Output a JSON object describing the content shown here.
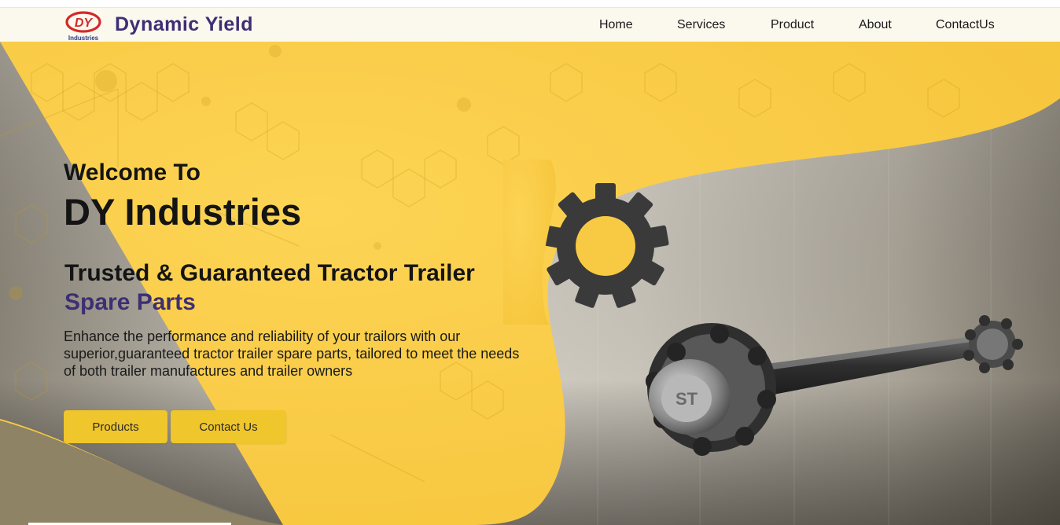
{
  "header": {
    "logo_initials": "DY",
    "logo_subtext": "Industries",
    "brand_name": "Dynamic Yield",
    "nav": [
      {
        "label": "Home"
      },
      {
        "label": "Services"
      },
      {
        "label": "Product"
      },
      {
        "label": "About"
      },
      {
        "label": "ContactUs"
      }
    ]
  },
  "hero": {
    "welcome": "Welcome To",
    "company": "DY Industries",
    "tagline": "Trusted & Guaranteed Tractor Trailer",
    "tagline_accent": "Spare Parts",
    "description": "Enhance the performance and reliability of your trailors with our superior,guaranteed tractor trailer spare parts, tailored to meet the needs of both trailer manufactures and trailer owners",
    "buttons": {
      "products": "Products",
      "contact": "Contact Us"
    }
  },
  "colors": {
    "brand": "#3d2f73",
    "accent_yellow": "#f9cb45",
    "button_yellow": "#efc62b",
    "nav_background": "#fbf8ee",
    "logo_red": "#d22a2a"
  },
  "icons": [
    "gear-icon",
    "axle-image",
    "dy-logo"
  ]
}
